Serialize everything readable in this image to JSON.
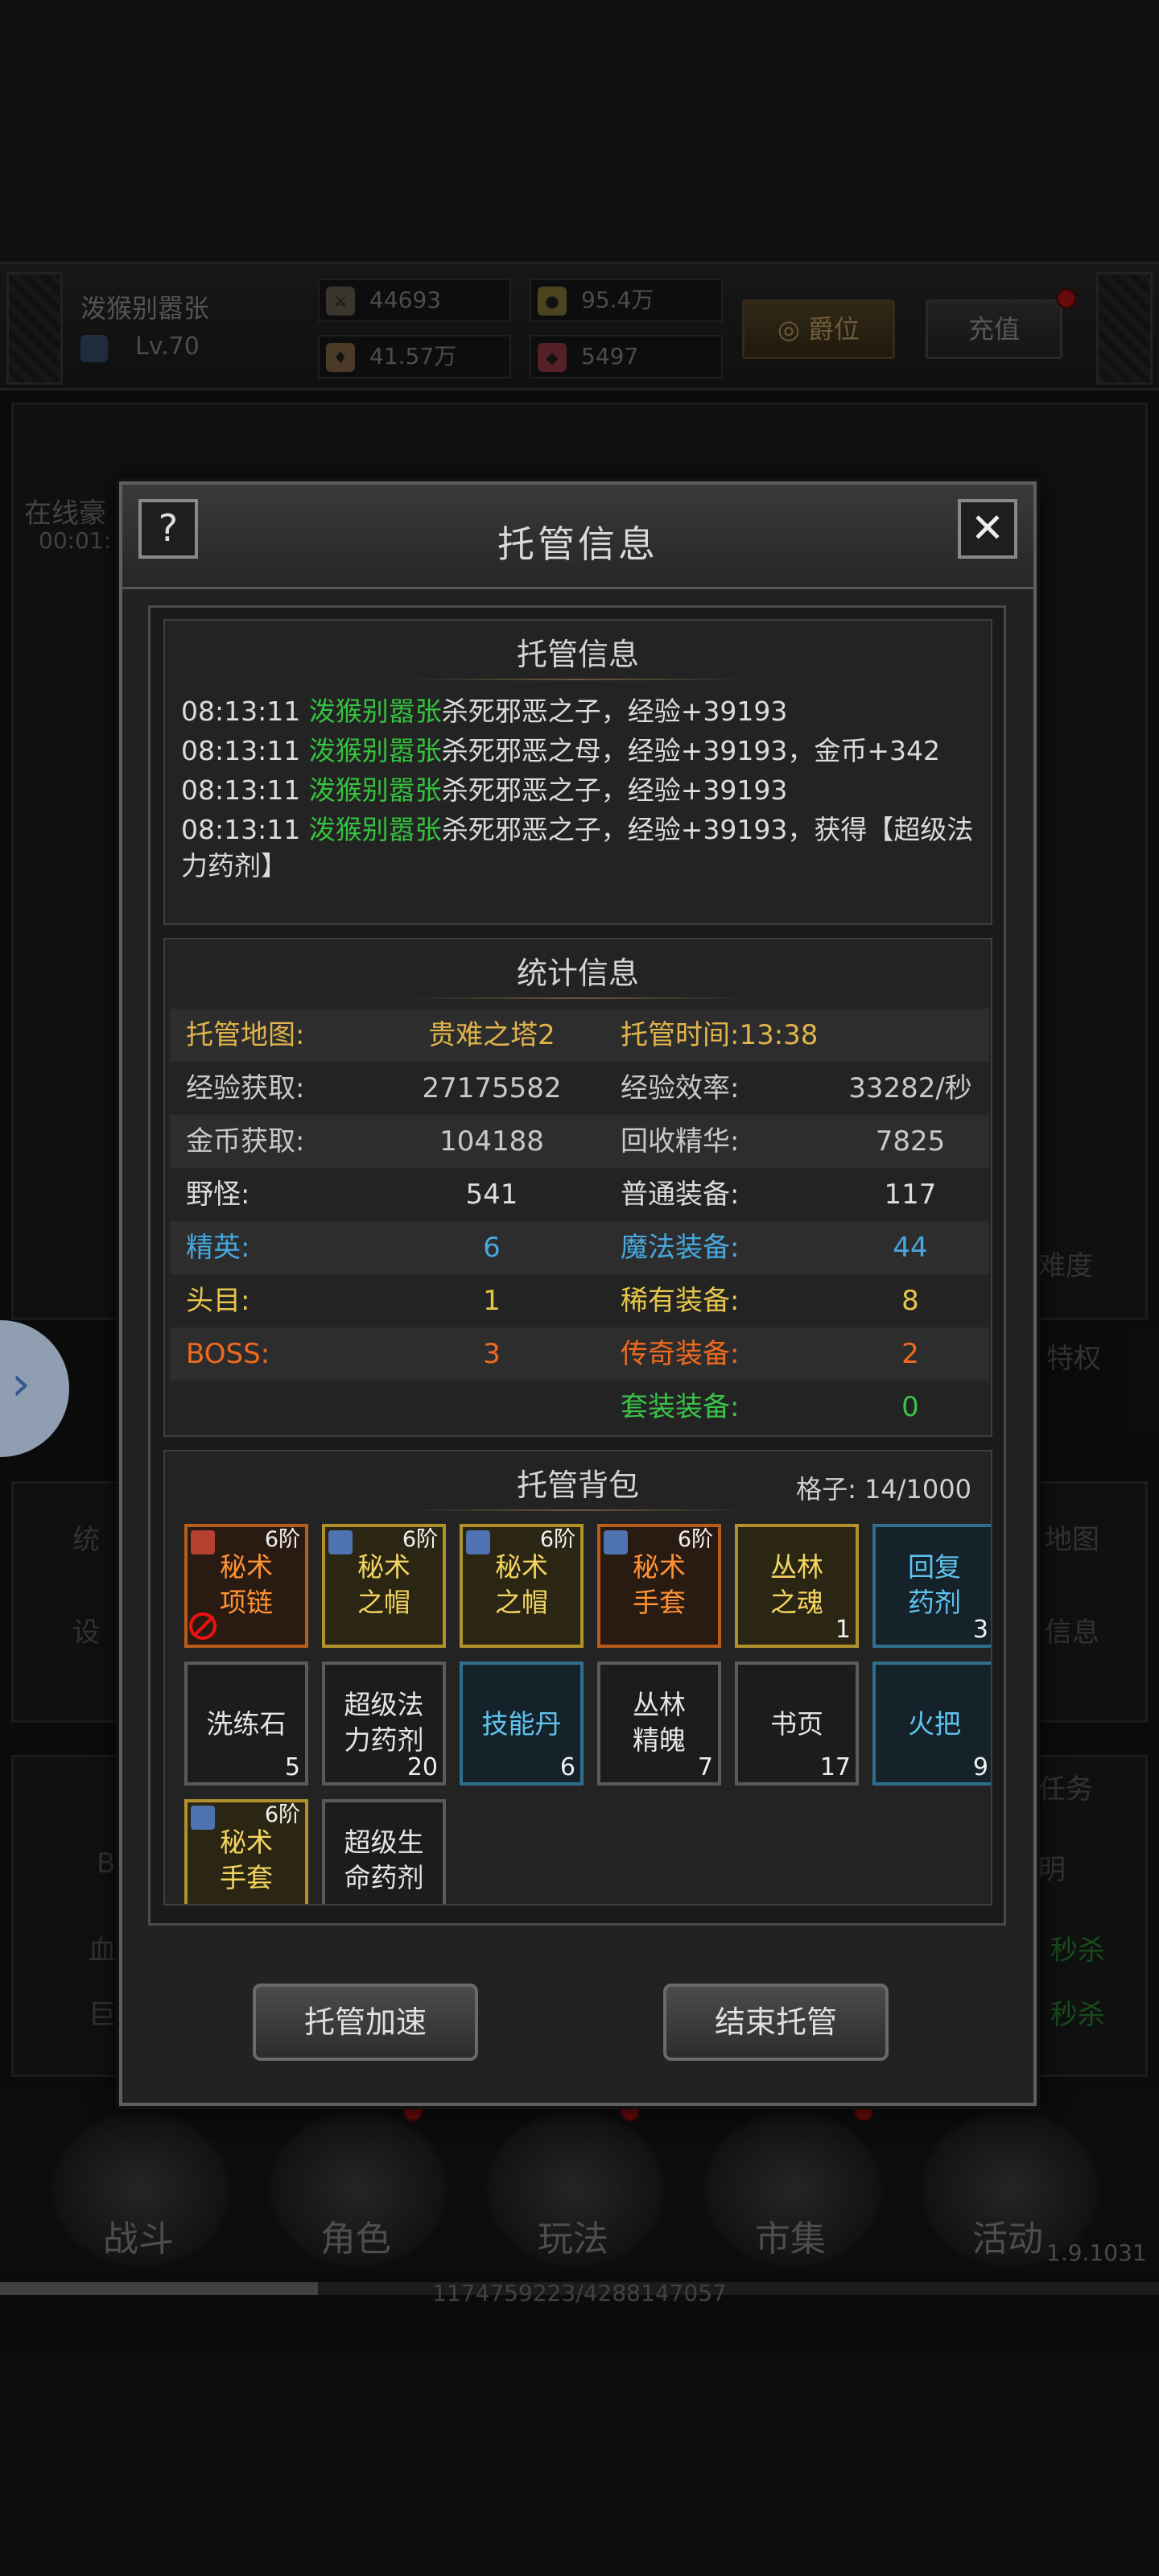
{
  "player": {
    "name": "泼猴别嚣张",
    "level": "Lv.70"
  },
  "hud_stats": {
    "power": "44693",
    "gold": "95.4万",
    "hp": "41.57万",
    "gems": "5497"
  },
  "hud_buttons": {
    "rank": "爵位",
    "recharge": "充值"
  },
  "background": {
    "online_label": "在线豪",
    "online_time": "00:01:",
    "left_tabs": [
      "统",
      "设"
    ],
    "right_tabs": [
      "地图",
      "信息"
    ],
    "task_label": "任务",
    "difficulty": "难度",
    "privilege": "特权",
    "explain": "明",
    "hint_left": [
      "B",
      "血",
      "巨"
    ],
    "right_green": [
      "秒杀",
      "秒杀"
    ]
  },
  "dialog": {
    "title": "托管信息",
    "help_label": "?",
    "close_label": "✕",
    "log_section": {
      "title": "托管信息",
      "entries": [
        {
          "time": "08:13:11",
          "name": "泼猴别嚣张",
          "text": "杀死邪恶之子，经验+39193"
        },
        {
          "time": "08:13:11",
          "name": "泼猴别嚣张",
          "text": "杀死邪恶之母，经验+39193，金币+342"
        },
        {
          "time": "08:13:11",
          "name": "泼猴别嚣张",
          "text": "杀死邪恶之子，经验+39193"
        },
        {
          "time": "08:13:11",
          "name": "泼猴别嚣张",
          "text": "杀死邪恶之子，经验+39193，获得【超级法力药剂】"
        }
      ]
    },
    "stats_section": {
      "title": "统计信息",
      "rows": [
        {
          "l1": "托管地图:",
          "v1": "贵难之塔2",
          "l2": "托管时间:13:38",
          "v2": "",
          "color": "#e0b44a"
        },
        {
          "l1": "经验获取:",
          "v1": "27175582",
          "l2": "经验效率:",
          "v2": "33282/秒",
          "color": "#c9c9c9"
        },
        {
          "l1": "金币获取:",
          "v1": "104188",
          "l2": "回收精华:",
          "v2": "7825",
          "color": "#c9c9c9"
        },
        {
          "l1": "野怪:",
          "v1": "541",
          "l2": "普通装备:",
          "v2": "117",
          "color": "#dcdcdc"
        },
        {
          "l1": "精英:",
          "v1": "6",
          "l2": "魔法装备:",
          "v2": "44",
          "color": "#47a8e0"
        },
        {
          "l1": "头目:",
          "v1": "1",
          "l2": "稀有装备:",
          "v2": "8",
          "color": "#e6c64a"
        },
        {
          "l1": "BOSS:",
          "v1": "3",
          "l2": "传奇装备:",
          "v2": "2",
          "color": "#f06a1e"
        },
        {
          "l1": "",
          "v1": "",
          "l2": "套装装备:",
          "v2": "0",
          "color": "#3bc24a"
        }
      ]
    },
    "bag_section": {
      "title": "托管背包",
      "capacity": "格子: 14/1000",
      "items": [
        {
          "name": "秘术项链",
          "line1": "秘术",
          "line2": "项链",
          "grade": "6阶",
          "qty": "",
          "rarity": "orange",
          "banned": true
        },
        {
          "name": "秘术之帽",
          "line1": "秘术",
          "line2": "之帽",
          "grade": "6阶",
          "qty": "",
          "rarity": "yellow",
          "banned": false
        },
        {
          "name": "秘术之帽",
          "line1": "秘术",
          "line2": "之帽",
          "grade": "6阶",
          "qty": "",
          "rarity": "yellow",
          "banned": false
        },
        {
          "name": "秘术手套",
          "line1": "秘术",
          "line2": "手套",
          "grade": "6阶",
          "qty": "",
          "rarity": "orange",
          "banned": false
        },
        {
          "name": "丛林之魂",
          "line1": "丛林",
          "line2": "之魂",
          "grade": "",
          "qty": "1",
          "rarity": "yellow",
          "banned": false
        },
        {
          "name": "回复药剂",
          "line1": "回复",
          "line2": "药剂",
          "grade": "",
          "qty": "3",
          "rarity": "blue",
          "banned": false
        },
        {
          "name": "洗练石",
          "line1": "洗练石",
          "line2": "",
          "grade": "",
          "qty": "5",
          "rarity": "gray",
          "banned": false
        },
        {
          "name": "超级法力药剂",
          "line1": "超级法",
          "line2": "力药剂",
          "grade": "",
          "qty": "20",
          "rarity": "gray",
          "banned": false
        },
        {
          "name": "技能丹",
          "line1": "技能丹",
          "line2": "",
          "grade": "",
          "qty": "6",
          "rarity": "blue",
          "banned": false
        },
        {
          "name": "丛林精魄",
          "line1": "丛林",
          "line2": "精魄",
          "grade": "",
          "qty": "7",
          "rarity": "gray",
          "banned": false
        },
        {
          "name": "书页",
          "line1": "书页",
          "line2": "",
          "grade": "",
          "qty": "17",
          "rarity": "gray",
          "banned": false
        },
        {
          "name": "火把",
          "line1": "火把",
          "line2": "",
          "grade": "",
          "qty": "9",
          "rarity": "blue",
          "banned": false
        },
        {
          "name": "秘术手套",
          "line1": "秘术",
          "line2": "手套",
          "grade": "6阶",
          "qty": "",
          "rarity": "yellow",
          "banned": false
        },
        {
          "name": "超级生命药剂",
          "line1": "超级生",
          "line2": "命药剂",
          "grade": "",
          "qty": "",
          "rarity": "gray",
          "banned": false
        }
      ]
    },
    "buttons": {
      "speed_up": "托管加速",
      "end": "结束托管"
    }
  },
  "bottom_nav": {
    "items": [
      "战斗",
      "角色",
      "玩法",
      "市集",
      "活动"
    ]
  },
  "version": "1.9.1031",
  "experience": {
    "text": "1174759223/4288147057",
    "fraction": 0.274
  }
}
